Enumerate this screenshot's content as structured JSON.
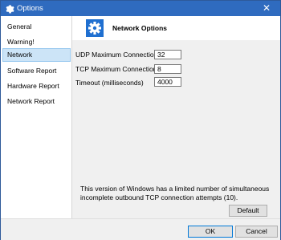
{
  "window": {
    "title": "Options",
    "close_symbol": "✕"
  },
  "sidebar": {
    "items": [
      {
        "label": "General"
      },
      {
        "label": "Warning!"
      },
      {
        "label": "Network"
      },
      {
        "label": "Software Report"
      },
      {
        "label": "Hardware Report"
      },
      {
        "label": "Network Report"
      }
    ],
    "selected_index": 2
  },
  "panel": {
    "heading": "Network Options",
    "icon": "gear-icon",
    "fields": [
      {
        "label": "UDP Maximum Connections",
        "value": "32"
      },
      {
        "label": "TCP Maximum Connections",
        "value": "8"
      },
      {
        "label": "Timeout (milliseconds)",
        "value": "4000"
      }
    ],
    "note": "This version of Windows has a limited number of simultaneous incomplete outbound TCP connection attempts (10).",
    "default_button": "Default"
  },
  "footer": {
    "ok_button": "OK",
    "cancel_button": "Cancel"
  },
  "colors": {
    "titlebar": "#2f6bbf",
    "accent": "#1f6fd0",
    "selection": "#cce4f7"
  }
}
